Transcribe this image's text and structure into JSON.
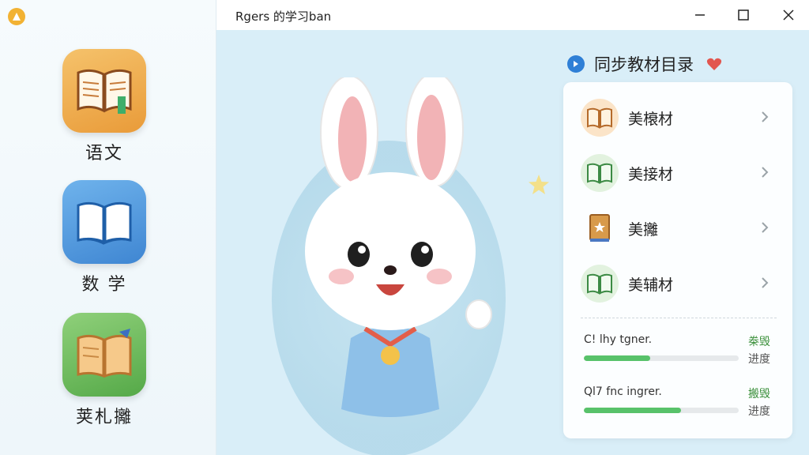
{
  "window": {
    "title": "Rgers 的学习ban"
  },
  "sidebar": {
    "subjects": [
      {
        "label": "语文",
        "icon": "book-bookmark-icon"
      },
      {
        "label": "数 学",
        "icon": "open-book-icon"
      },
      {
        "label": "荚札攡",
        "icon": "storybook-icon"
      }
    ]
  },
  "panel": {
    "title": "同步教材目录",
    "books": [
      {
        "label": "美榱材",
        "icon": "book-icon"
      },
      {
        "label": "美接材",
        "icon": "book-icon"
      },
      {
        "label": "美攡",
        "icon": "closed-book-icon"
      },
      {
        "label": "美辅材",
        "icon": "book-icon"
      }
    ],
    "progress": [
      {
        "label": "C! lhy tgner.",
        "tag": "桊毁",
        "status": "进度",
        "value": 0.43
      },
      {
        "label": "Ql7 fnc ingrer.",
        "tag": "搬毁",
        "status": "进度",
        "value": 0.63
      }
    ]
  },
  "colors": {
    "accent": "#2f7fd6",
    "progress": "#58c26a",
    "heart": "#e2564f"
  }
}
